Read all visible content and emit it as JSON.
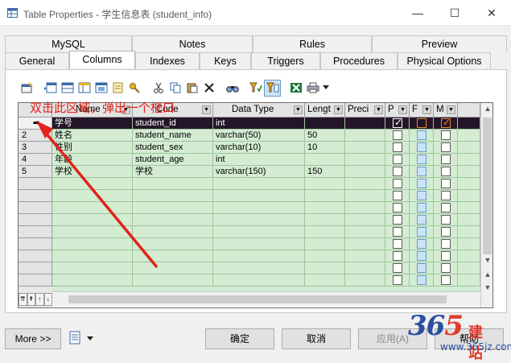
{
  "window": {
    "title": "Table Properties - 学生信息表 (student_info)",
    "minimize": "—",
    "maximize": "☐",
    "close": "✕"
  },
  "tabs": {
    "back_row": [
      "MySQL",
      "Notes",
      "Rules",
      "Preview"
    ],
    "front_row": [
      "General",
      "Columns",
      "Indexes",
      "Keys",
      "Triggers",
      "Procedures",
      "Physical Options"
    ],
    "active": "Columns"
  },
  "toolbar": {
    "icons": [
      "properties-icon",
      "insert-row-icon",
      "add-row-icon",
      "add-columns-icon",
      "add-attribute-icon",
      "reuse-attribute-icon",
      "key-icon",
      "cut-icon",
      "copy-icon",
      "paste-icon",
      "delete-icon",
      "find-icon",
      "filter-icon",
      "customize-columns-icon",
      "export-excel-icon",
      "print-icon",
      "dropdown-icon"
    ]
  },
  "grid": {
    "columns": [
      "Name",
      "Code",
      "Data Type",
      "Lengt",
      "Preci",
      "P",
      "F",
      "M"
    ],
    "current_row_marker": "➡",
    "rows": [
      {
        "num": "",
        "name": "学号",
        "code": "student_id",
        "type": "int",
        "length": "",
        "precision": "",
        "p": true,
        "f": false,
        "m": true
      },
      {
        "num": "2",
        "name": "姓名",
        "code": "student_name",
        "type": "varchar(50)",
        "length": "50",
        "precision": "",
        "p": false,
        "f": false,
        "m": false
      },
      {
        "num": "3",
        "name": "性别",
        "code": "student_sex",
        "type": "varchar(10)",
        "length": "10",
        "precision": "",
        "p": false,
        "f": false,
        "m": false
      },
      {
        "num": "4",
        "name": "年龄",
        "code": "student_age",
        "type": "int",
        "length": "",
        "precision": "",
        "p": false,
        "f": false,
        "m": false
      },
      {
        "num": "5",
        "name": "学校",
        "code": "学校",
        "type": "varchar(150)",
        "length": "150",
        "precision": "",
        "p": false,
        "f": false,
        "m": false
      }
    ],
    "nav_buttons": [
      "⇈",
      "↟",
      "↑",
      "↓",
      "↡",
      "⇊"
    ]
  },
  "annotation": {
    "text": "双击此区域，弹出一个框口"
  },
  "buttons": {
    "more": "More >>",
    "ok": "确定",
    "cancel": "取消",
    "apply": "应用(A)",
    "help": "帮助"
  },
  "watermark": {
    "num_a": "36",
    "num_b": "5",
    "cn": "建站",
    "url": "www.365jz.com"
  },
  "colors": {
    "row_fill": "#d3ecd2",
    "selected_row": "#241628",
    "annotation": "#e2231a"
  }
}
